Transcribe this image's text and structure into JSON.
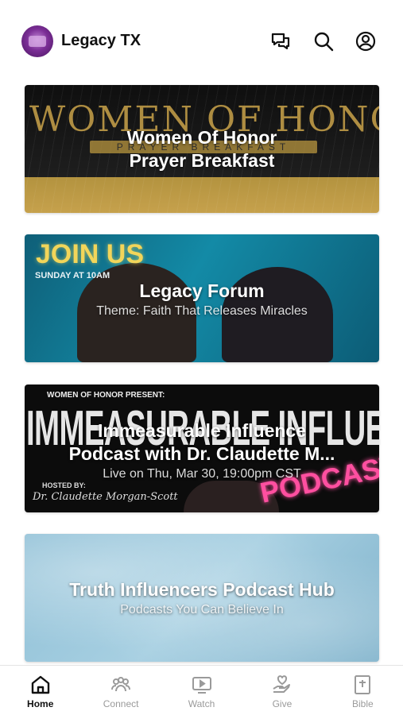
{
  "header": {
    "title": "Legacy TX",
    "logo_icon": "church-logo-icon",
    "icons": [
      "chat-icon",
      "search-icon",
      "account-icon"
    ]
  },
  "cards": [
    {
      "title_line1": "Women Of Honor",
      "title_line2": "Prayer Breakfast",
      "art_heading": "WOMEN OF HONOR",
      "art_band": "PRAYER BREAKFAST"
    },
    {
      "title": "Legacy Forum",
      "subtitle": "Theme: Faith That Releases Miracles",
      "art_heading": "JOIN US",
      "art_sub": "SUNDAY AT 10AM"
    },
    {
      "title_line1": "Immeasurable Influence",
      "title_line2": "Podcast with Dr. Claudette M...",
      "subtitle": "Live on Thu, Mar 30, 19:00pm CST",
      "art_top": "WOMEN OF HONOR PRESENT:",
      "art_big": "IMMEASURABLE INFLUENCE",
      "art_host": "HOSTED BY:",
      "art_sign": "Dr. Claudette Morgan-Scott",
      "art_podcast": "PODCAST"
    },
    {
      "title": "Truth Influencers Podcast Hub",
      "subtitle": "Podcasts You Can Believe In"
    }
  ],
  "tabs": [
    {
      "label": "Home",
      "icon": "home-icon",
      "active": true
    },
    {
      "label": "Connect",
      "icon": "people-icon",
      "active": false
    },
    {
      "label": "Watch",
      "icon": "play-screen-icon",
      "active": false
    },
    {
      "label": "Give",
      "icon": "heart-hand-icon",
      "active": false
    },
    {
      "label": "Bible",
      "icon": "bible-icon",
      "active": false
    }
  ],
  "colors": {
    "accent": "#111111",
    "inactive": "#9a9a9a",
    "gold": "#c6a14c",
    "teal": "#138aa6",
    "pink": "#ff4fa0"
  }
}
